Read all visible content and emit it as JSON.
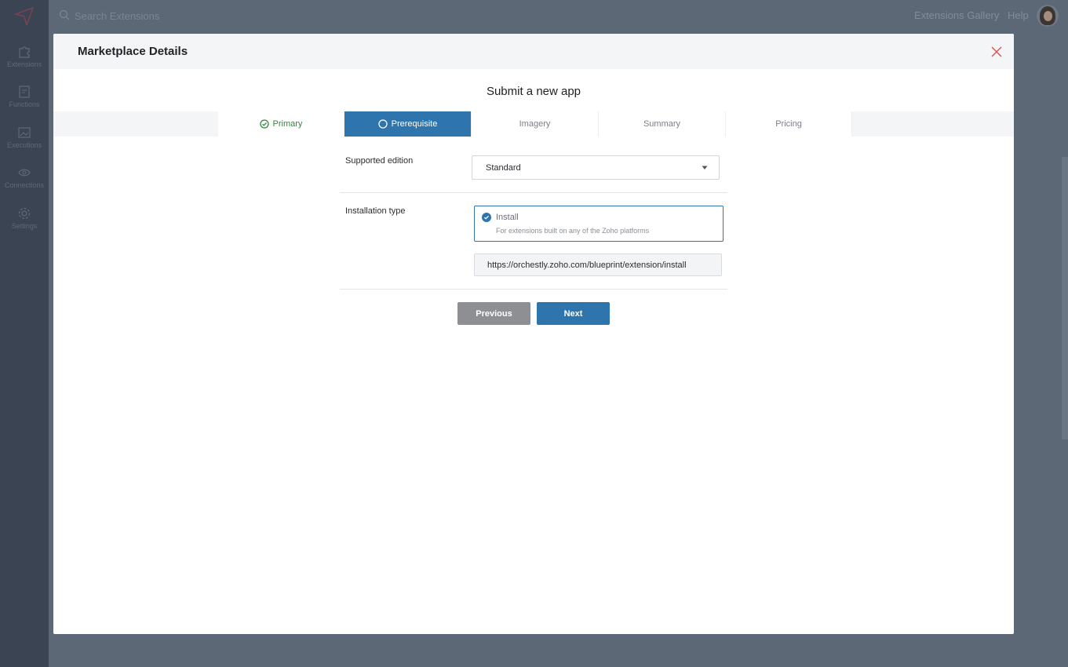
{
  "app": {
    "search": {
      "placeholder": "Search Extensions"
    },
    "sidebar": {
      "items": [
        {
          "label": "Extensions",
          "icon": "puzzle-icon"
        },
        {
          "label": "Functions",
          "icon": "functions-icon"
        },
        {
          "label": "Executions",
          "icon": "executions-icon"
        },
        {
          "label": "Connections",
          "icon": "connections-icon"
        },
        {
          "label": "Settings",
          "icon": "gear-icon"
        }
      ]
    },
    "topbar": {
      "gallery_link": "Extensions Gallery",
      "help_link": "Help"
    }
  },
  "modal": {
    "title": "Marketplace Details",
    "subtitle": "Submit a new app",
    "tabs": [
      {
        "label": "Primary",
        "state": "completed"
      },
      {
        "label": "Prerequisite",
        "state": "active"
      },
      {
        "label": "Imagery",
        "state": "pending"
      },
      {
        "label": "Summary",
        "state": "pending"
      },
      {
        "label": "Pricing",
        "state": "pending"
      }
    ],
    "supported_edition": {
      "label": "Supported edition",
      "value": "Standard"
    },
    "installation_type": {
      "label": "Installation type",
      "option_label": "Install",
      "option_desc": "For extensions built on any of the Zoho platforms",
      "url": "https://orchestly.zoho.com/blueprint/extension/install"
    },
    "buttons": {
      "previous": "Previous",
      "next": "Next"
    }
  },
  "colors": {
    "accent": "#2f75ad",
    "success": "#2f8a3a",
    "close": "#d9534f",
    "overlay": "#5d6877",
    "sidebar": "#3a4452",
    "button_secondary": "#8d8f92"
  }
}
